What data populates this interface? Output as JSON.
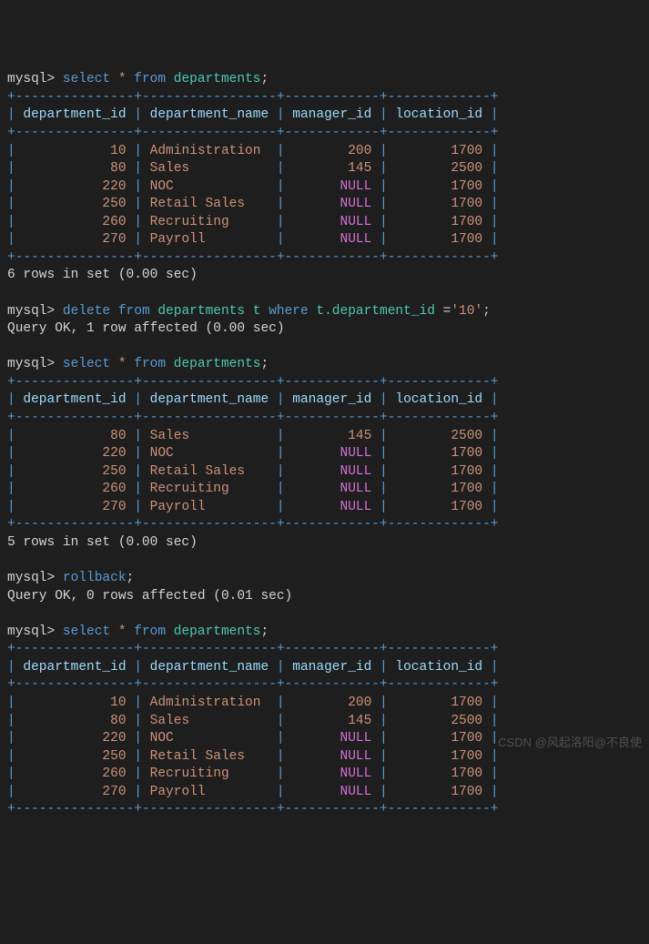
{
  "prompt": "mysql> ",
  "kw_select": "select",
  "kw_from": "from",
  "kw_delete": "delete",
  "kw_where": "where",
  "kw_rollback": "rollback",
  "star": "*",
  "table": "departments",
  "alias": "t",
  "cond_col": "t.department_id",
  "cond_op": "=",
  "cond_val": "'10'",
  "semi": ";",
  "border_sep": "+---------------+-----------------+------------+-------------+",
  "cols": {
    "c1": "department_id",
    "c2": "department_name",
    "c3": "manager_id",
    "c4": "location_id"
  },
  "t1": {
    "rowcount": "6 rows in set (0.00 sec)",
    "rows": [
      {
        "c1": "10",
        "c2": "Administration",
        "c3": "200",
        "c3null": false,
        "c4": "1700"
      },
      {
        "c1": "80",
        "c2": "Sales",
        "c3": "145",
        "c3null": false,
        "c4": "2500"
      },
      {
        "c1": "220",
        "c2": "NOC",
        "c3": "NULL",
        "c3null": true,
        "c4": "1700"
      },
      {
        "c1": "250",
        "c2": "Retail Sales",
        "c3": "NULL",
        "c3null": true,
        "c4": "1700"
      },
      {
        "c1": "260",
        "c2": "Recruiting",
        "c3": "NULL",
        "c3null": true,
        "c4": "1700"
      },
      {
        "c1": "270",
        "c2": "Payroll",
        "c3": "NULL",
        "c3null": true,
        "c4": "1700"
      }
    ]
  },
  "delete_result": "Query OK, 1 row affected (0.00 sec)",
  "t2": {
    "rowcount": "5 rows in set (0.00 sec)",
    "rows": [
      {
        "c1": "80",
        "c2": "Sales",
        "c3": "145",
        "c3null": false,
        "c4": "2500"
      },
      {
        "c1": "220",
        "c2": "NOC",
        "c3": "NULL",
        "c3null": true,
        "c4": "1700"
      },
      {
        "c1": "250",
        "c2": "Retail Sales",
        "c3": "NULL",
        "c3null": true,
        "c4": "1700"
      },
      {
        "c1": "260",
        "c2": "Recruiting",
        "c3": "NULL",
        "c3null": true,
        "c4": "1700"
      },
      {
        "c1": "270",
        "c2": "Payroll",
        "c3": "NULL",
        "c3null": true,
        "c4": "1700"
      }
    ]
  },
  "rollback_result": "Query OK, 0 rows affected (0.01 sec)",
  "t3": {
    "rows": [
      {
        "c1": "10",
        "c2": "Administration",
        "c3": "200",
        "c3null": false,
        "c4": "1700"
      },
      {
        "c1": "80",
        "c2": "Sales",
        "c3": "145",
        "c3null": false,
        "c4": "2500"
      },
      {
        "c1": "220",
        "c2": "NOC",
        "c3": "NULL",
        "c3null": true,
        "c4": "1700"
      },
      {
        "c1": "250",
        "c2": "Retail Sales",
        "c3": "NULL",
        "c3null": true,
        "c4": "1700"
      },
      {
        "c1": "260",
        "c2": "Recruiting",
        "c3": "NULL",
        "c3null": true,
        "c4": "1700"
      },
      {
        "c1": "270",
        "c2": "Payroll",
        "c3": "NULL",
        "c3null": true,
        "c4": "1700"
      }
    ]
  },
  "watermark": "CSDN @风起洛阳@不良使"
}
